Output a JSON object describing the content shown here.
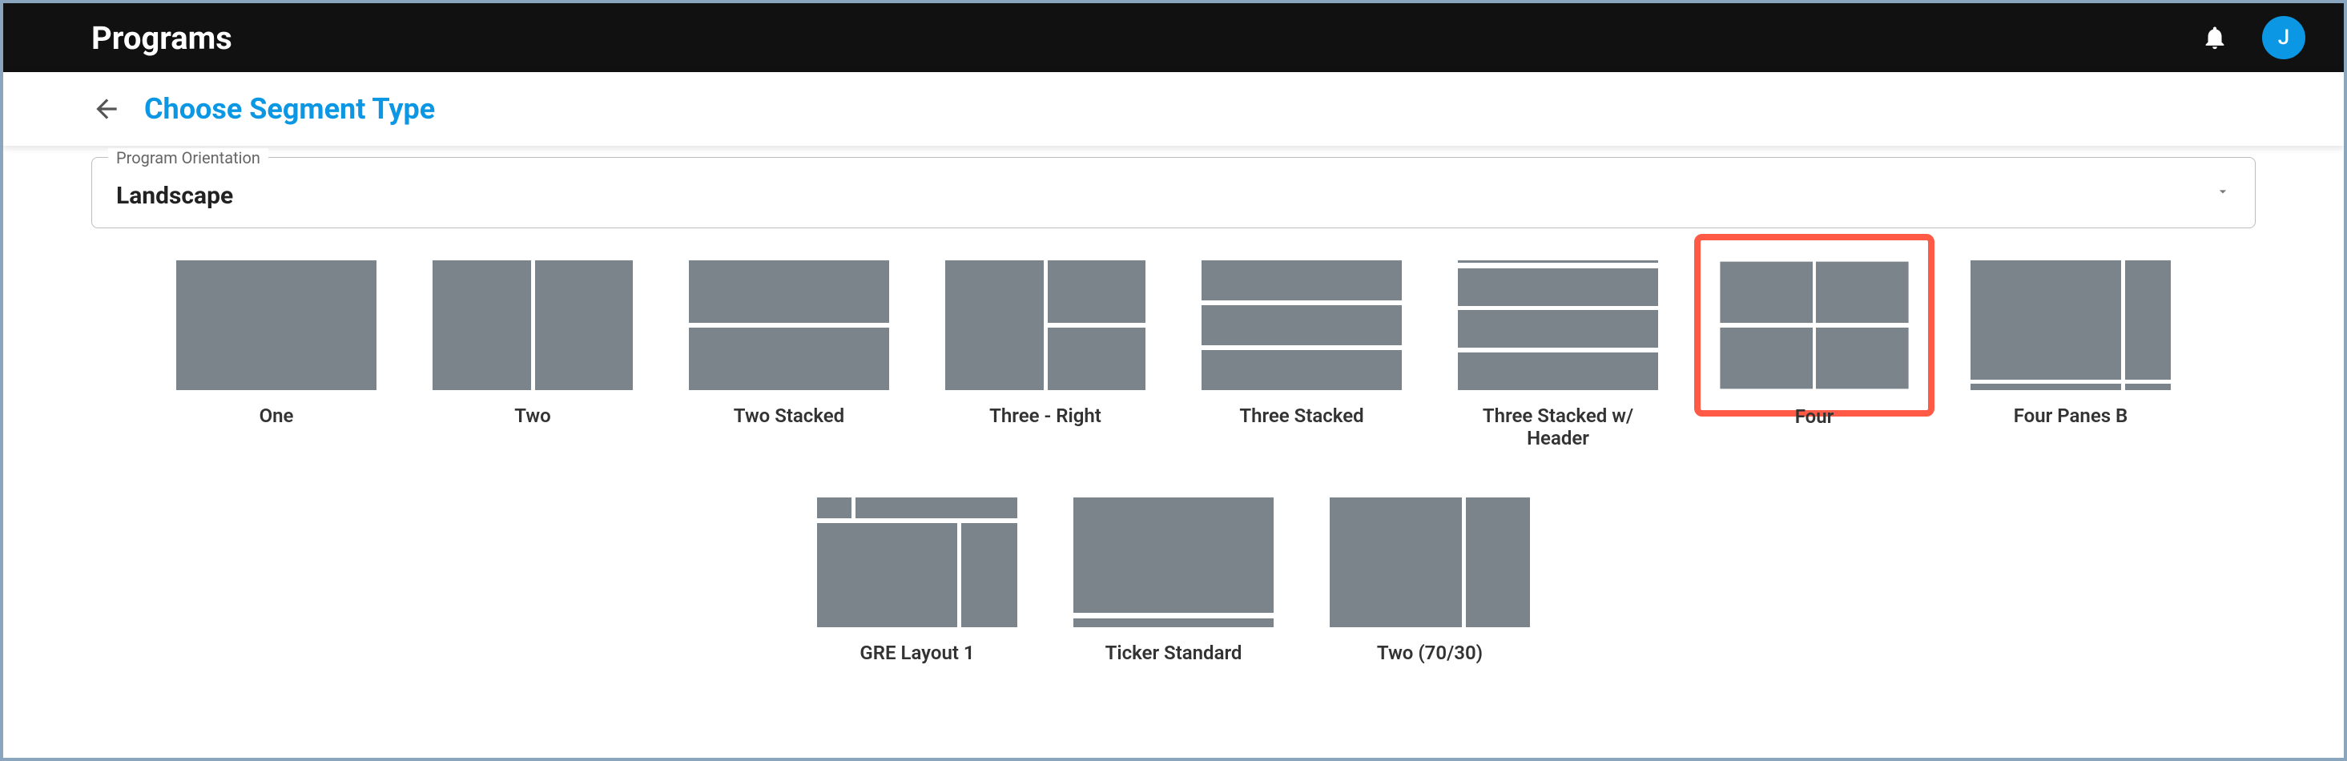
{
  "topbar": {
    "title": "Programs",
    "avatar_initial": "J"
  },
  "subheader": {
    "title": "Choose Segment Type"
  },
  "orientation": {
    "legend": "Program Orientation",
    "value": "Landscape"
  },
  "tiles": [
    {
      "id": "one",
      "label": "One",
      "layout": "l-one",
      "selected": false
    },
    {
      "id": "two",
      "label": "Two",
      "layout": "l-two",
      "selected": false
    },
    {
      "id": "two-stacked",
      "label": "Two Stacked",
      "layout": "l-two-stacked",
      "selected": false
    },
    {
      "id": "three-right",
      "label": "Three - Right",
      "layout": "l-three-right",
      "selected": false
    },
    {
      "id": "three-stacked",
      "label": "Three Stacked",
      "layout": "l-three-stacked",
      "selected": false
    },
    {
      "id": "three-stacked-header",
      "label": "Three Stacked w/ Header",
      "layout": "l-three-header",
      "selected": false
    },
    {
      "id": "four",
      "label": "Four",
      "layout": "l-four",
      "selected": true
    },
    {
      "id": "four-panes-b",
      "label": "Four Panes B",
      "layout": "l-four-b",
      "selected": false
    },
    {
      "id": "gre-layout-1",
      "label": "GRE Layout 1",
      "layout": "l-gre",
      "selected": false
    },
    {
      "id": "ticker-standard",
      "label": "Ticker Standard",
      "layout": "l-ticker",
      "selected": false
    },
    {
      "id": "two-70-30",
      "label": "Two (70/30)",
      "layout": "l-two-7030",
      "selected": false
    }
  ]
}
